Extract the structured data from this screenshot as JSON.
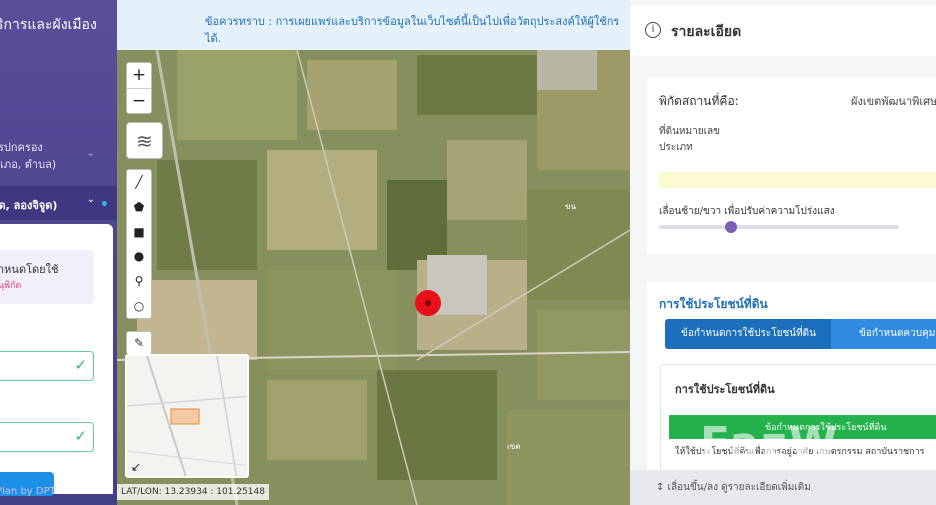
{
  "sidebar": {
    "title": "ริการและผังเมือง",
    "menu1_line1": "รปกครอง",
    "menu1_line2": "ำเภอ, ตำบล)",
    "menu2_label": "จูด, ลองจิจูด)",
    "card_title": "ำหนดโดยใช้",
    "card_sub": "นุพิกัด",
    "credit": "Plan by DPT."
  },
  "map": {
    "notice_line1": "ข้อควรทราบ : การเผยแพร่และบริการข้อมูลในเว็บไซต์นี้เป็นไปเพื่อวัตถุประสงค์ให้ผู้ใช้กร",
    "notice_line2": "ได้.",
    "zoom_in": "+",
    "zoom_out": "−",
    "latlon": "LAT/LON: 13.23934 : 101.25148",
    "label_b": "ขน",
    "label_c": "เขต"
  },
  "details": {
    "back_icon": "➪",
    "title": "รายละเอียด",
    "location_label": "พิกัดสถานที่คือ:",
    "location_value": "ผังเขตพัฒนาพิเศษ",
    "parcel_label": "ที่ดินหมายเลข",
    "type_label": "ประเภท",
    "opacity_label": "เลื่อนซ้าย/ขวา เพื่อปรับค่าความโปร่งแสง",
    "opacity_value": 0.3,
    "landuse_heading": "การใช้ประโยชน์ที่ดิน",
    "tab_active": "ข้อกำหนดการใช้ประโยชน์ที่ดิน",
    "tab_other": "ข้อกำหนดควบคุม",
    "inner_heading": "การใช้ประโยชน์ที่ดิน",
    "green_bar": "ข้อกำหนดการใช้ประโยชน์ที่ดิน",
    "body_text": "ให้ใช้ประโยชน์ที่ดินเพื่อการอยู่อาศัย เกษตรกรรม สถาบันราชการ",
    "footer": "↕ เลื่อนขึ้น/ลง ดูรายละเอียดเพิ่มเติม",
    "watermark": "FazW"
  },
  "colors": {
    "sidebar": "#4e4692",
    "accent_blue": "#1c6fbd",
    "green": "#23b24b",
    "marker": "#e8111b"
  }
}
